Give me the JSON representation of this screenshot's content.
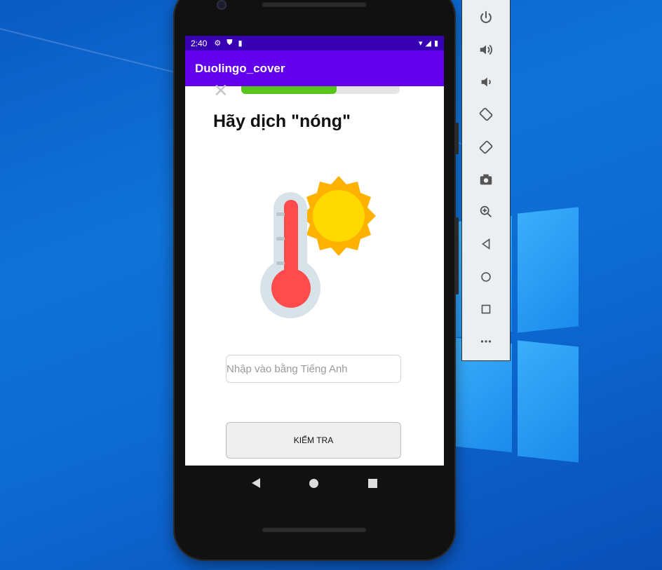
{
  "status_bar": {
    "time": "2:40",
    "icons": [
      "gear-icon",
      "shield-icon",
      "sd-card-icon",
      "wifi-icon",
      "signal-icon",
      "battery-icon"
    ]
  },
  "app_bar": {
    "title": "Duolingo_cover"
  },
  "lesson": {
    "progress": 0.6,
    "question": "Hãy dịch \"nóng\"",
    "illustration": "thermometer-sun-icon",
    "input_placeholder": "Nhập vào bằng Tiếng Anh",
    "check_label": "KIỂM TRA"
  },
  "nav_bar": [
    "back-icon",
    "home-icon",
    "recent-apps-icon"
  ],
  "emulator_toolbar": {
    "tools": [
      "power-icon",
      "volume-up-icon",
      "volume-down-icon",
      "rotate-left-icon",
      "rotate-right-icon",
      "camera-icon",
      "zoom-icon",
      "back-icon",
      "home-icon",
      "overview-icon",
      "more-icon"
    ]
  },
  "colors": {
    "status_bar": "#3700b3",
    "app_bar": "#6200ee",
    "progress": "#58c51b",
    "thermometer_red": "#ff4b4b",
    "sun_yellow": "#ffd900"
  }
}
